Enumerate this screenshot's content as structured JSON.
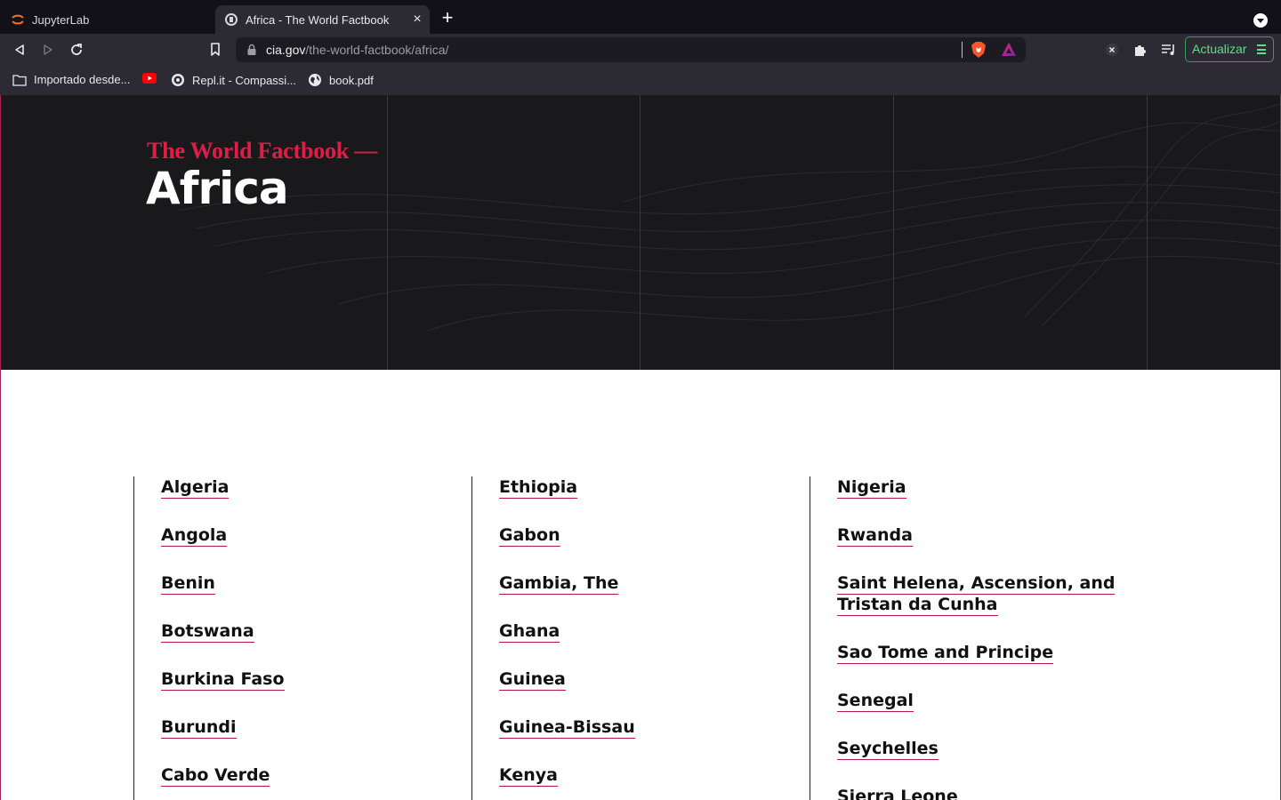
{
  "browser": {
    "tabs": [
      {
        "title": "JupyterLab",
        "active": false
      },
      {
        "title": "Africa - The World Factbook",
        "active": true
      }
    ],
    "url_host": "cia.gov",
    "url_path": "/the-world-factbook/africa/",
    "update_label": "Actualizar",
    "bookmarks": [
      {
        "label": "Importado desde...",
        "icon": "folder-icon"
      },
      {
        "label": "",
        "icon": "youtube-icon"
      },
      {
        "label": "Repl.it - Compassi...",
        "icon": "replit-icon"
      },
      {
        "label": "book.pdf",
        "icon": "globe-icon"
      }
    ],
    "accent_color": "#5fdc8c"
  },
  "hero": {
    "kicker": "The World Factbook —",
    "title": "Africa",
    "kicker_color": "#e01c48",
    "background": "#19191c"
  },
  "countries": {
    "columns": [
      [
        "Algeria",
        "Angola",
        "Benin",
        "Botswana",
        "Burkina Faso",
        "Burundi",
        "Cabo Verde"
      ],
      [
        "Ethiopia",
        "Gabon",
        "Gambia, The",
        "Ghana",
        "Guinea",
        "Guinea-Bissau",
        "Kenya"
      ],
      [
        "Nigeria",
        "Rwanda",
        "Saint Helena, Ascension, and",
        "Tristan da Cunha",
        "Sao Tome and Principe",
        "Senegal",
        "Seychelles",
        "Sierra Leone"
      ]
    ],
    "underline_color": "#b61648"
  }
}
